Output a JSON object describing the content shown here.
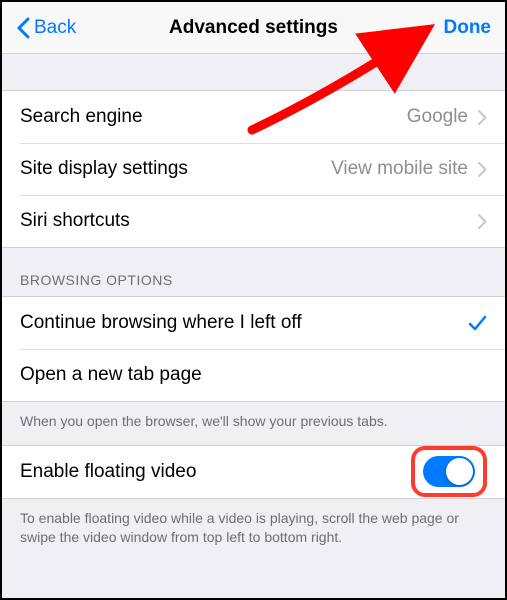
{
  "header": {
    "back_label": "Back",
    "title": "Advanced settings",
    "done_label": "Done"
  },
  "rows": {
    "search_engine_label": "Search engine",
    "search_engine_value": "Google",
    "site_display_label": "Site display settings",
    "site_display_value": "View mobile site",
    "siri_label": "Siri shortcuts"
  },
  "browsing": {
    "section_title": "BROWSING OPTIONS",
    "continue_label": "Continue browsing where I left off",
    "new_tab_label": "Open a new tab page",
    "footer": "When you open the browser, we'll show your previous tabs."
  },
  "floating": {
    "label": "Enable floating video",
    "toggle_on": true,
    "footer": "To enable floating video while a video is playing, scroll the web page or swipe the video window from top left to bottom right."
  },
  "colors": {
    "accent": "#007aff",
    "highlight": "#ff3b30"
  }
}
